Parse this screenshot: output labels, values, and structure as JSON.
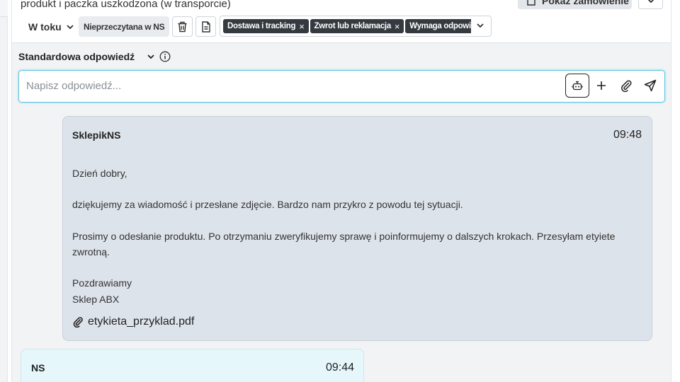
{
  "ticket": {
    "subject": "produkt i paczka uszkodzona (w transporcie)",
    "show_order_label": "Pokaż zamówienie",
    "status": "W toku",
    "unread_label": "Nieprzeczytana w NS",
    "labels": [
      "Dostawa i tracking",
      "Zwrot lub reklamacja",
      "Wymaga odpowiedzi"
    ]
  },
  "reply": {
    "template_label": "Standardowa odpowiedź",
    "placeholder": "Napisz odpowiedź..."
  },
  "messages": [
    {
      "author": "SklepikNS",
      "time": "09:48",
      "body": [
        "Dzień dobry,",
        "dziękujemy za wiadomość i przesłane zdjęcie. Bardzo nam przykro z powodu tej sytuacji.",
        "Prosimy o odesłanie produktu. Po otrzymaniu zweryfikujemy sprawę i poinformujemy o dalszych krokach. Przesyłam etyiete zwrotną.",
        "Pozdrawiamy",
        "Sklep ABX"
      ],
      "attachment": "etykieta_przyklad.pdf"
    },
    {
      "author": "NS",
      "time": "09:44"
    }
  ],
  "colors": {
    "focus_border": "#55c4e0",
    "outgoing_bg": "#dde3ea",
    "incoming_bg": "#e6f7fc",
    "label_chip_bg": "#343a40"
  }
}
